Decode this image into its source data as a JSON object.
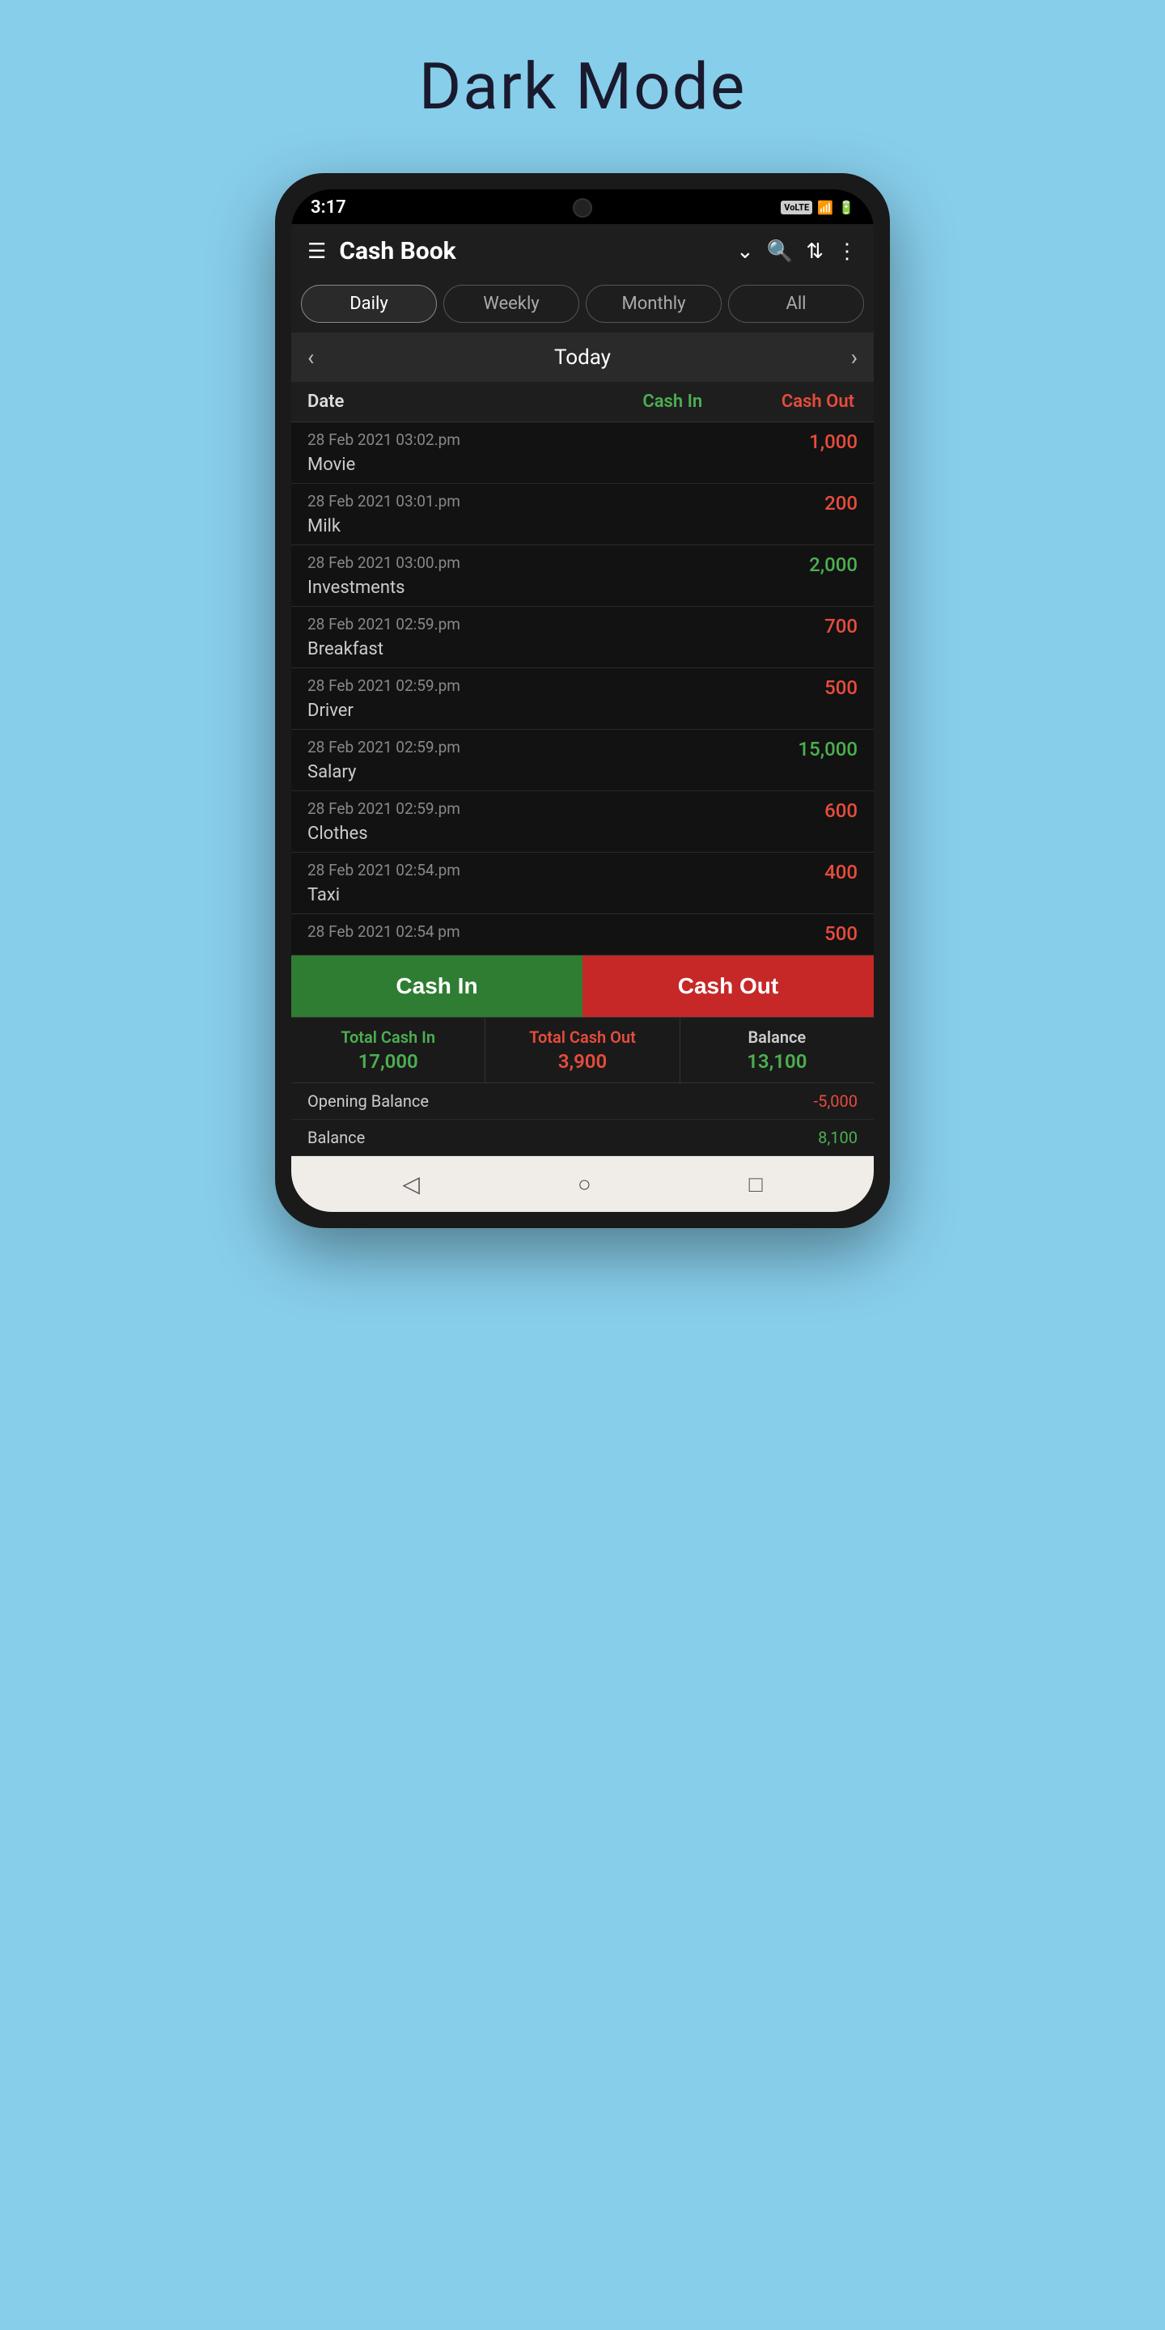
{
  "page": {
    "title": "Dark Mode"
  },
  "statusBar": {
    "time": "3:17",
    "volte": "VoLTE"
  },
  "appBar": {
    "title": "Cash Book",
    "icons": {
      "menu": "☰",
      "dropdown": "⌄",
      "search": "🔍",
      "sort": "⇅",
      "more": "⋮"
    }
  },
  "tabs": [
    {
      "label": "Daily",
      "active": true
    },
    {
      "label": "Weekly",
      "active": false
    },
    {
      "label": "Monthly",
      "active": false
    },
    {
      "label": "All",
      "active": false
    }
  ],
  "dateNav": {
    "label": "Today",
    "prevArrow": "‹",
    "nextArrow": "›"
  },
  "tableHeader": {
    "date": "Date",
    "cashIn": "Cash In",
    "cashOut": "Cash Out"
  },
  "transactions": [
    {
      "date": "28 Feb 2021 03:02.pm",
      "name": "Movie",
      "cashIn": "",
      "cashOut": "1,000"
    },
    {
      "date": "28 Feb 2021 03:01.pm",
      "name": "Milk",
      "cashIn": "",
      "cashOut": "200"
    },
    {
      "date": "28 Feb 2021 03:00.pm",
      "name": "Investments",
      "cashIn": "2,000",
      "cashOut": ""
    },
    {
      "date": "28 Feb 2021 02:59.pm",
      "name": "Breakfast",
      "cashIn": "",
      "cashOut": "700"
    },
    {
      "date": "28 Feb 2021 02:59.pm",
      "name": "Driver",
      "cashIn": "",
      "cashOut": "500"
    },
    {
      "date": "28 Feb 2021 02:59.pm",
      "name": "Salary",
      "cashIn": "15,000",
      "cashOut": ""
    },
    {
      "date": "28 Feb 2021 02:59.pm",
      "name": "Clothes",
      "cashIn": "",
      "cashOut": "600"
    },
    {
      "date": "28 Feb 2021 02:54.pm",
      "name": "Taxi",
      "cashIn": "",
      "cashOut": "400"
    },
    {
      "date": "28 Feb 2021 02:54 pm",
      "name": "",
      "cashIn": "",
      "cashOut": "500"
    }
  ],
  "actionButtons": {
    "cashIn": "Cash In",
    "cashOut": "Cash Out"
  },
  "summary": {
    "totalCashInLabel": "Total Cash In",
    "totalCashInValue": "17,000",
    "totalCashOutLabel": "Total Cash Out",
    "totalCashOutValue": "3,900",
    "balanceLabel": "Balance",
    "balanceValue": "13,100",
    "openingBalanceLabel": "Opening Balance",
    "openingBalanceValue": "-5,000",
    "finalBalanceLabel": "Balance",
    "finalBalanceValue": "8,100"
  },
  "navBar": {
    "back": "◁",
    "home": "○",
    "recent": "□"
  }
}
